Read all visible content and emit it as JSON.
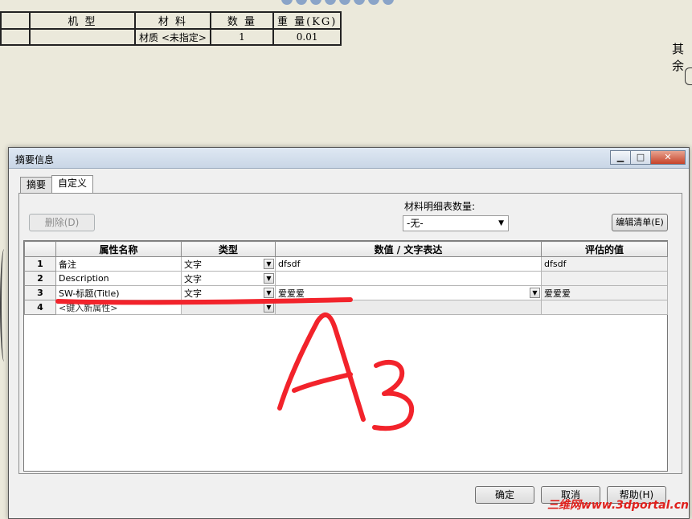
{
  "bom": {
    "headers": [
      "机 型",
      "材 料",
      "数 量",
      "重 量(KG)"
    ],
    "row": [
      "",
      "材质 <未指定>",
      "1",
      "0.01"
    ]
  },
  "side_text": "其余",
  "dialog": {
    "title": "摘要信息",
    "controls": {
      "minimize": "▁",
      "maximize": "□",
      "close": "✕"
    },
    "tabs": [
      {
        "label": "摘要"
      },
      {
        "label": "自定义"
      }
    ],
    "delete_button": "删除(D)",
    "bom_qty_label": "材料明细表数量:",
    "bom_qty_value": "-无-",
    "edit_list_button": "编辑清单(E)",
    "grid": {
      "columns": [
        "",
        "属性名称",
        "类型",
        "数值 / 文字表达",
        "评估的值"
      ],
      "rows": [
        {
          "num": "1",
          "name": "备注",
          "type": "文字",
          "value": "dfsdf",
          "evaluated": "dfsdf"
        },
        {
          "num": "2",
          "name": "Description",
          "type": "文字",
          "value": "",
          "evaluated": ""
        },
        {
          "num": "3",
          "name": "SW-标题(Title)",
          "type": "文字",
          "value": "爱爱爱",
          "evaluated": "爱爱爱"
        },
        {
          "num": "4",
          "name": "<键入新属性>",
          "type": "",
          "value": "",
          "evaluated": ""
        }
      ]
    },
    "buttons": {
      "ok": "确定",
      "cancel": "取消",
      "help": "帮助(H)"
    }
  },
  "annotation": {
    "handwriting": "A3",
    "color": "#f2232b"
  },
  "watermark": "三维网www.3dportal.cn",
  "colors": {
    "background": "#ebe9db",
    "dialog": "#f0f0f0",
    "close_button": "#c7432a"
  }
}
